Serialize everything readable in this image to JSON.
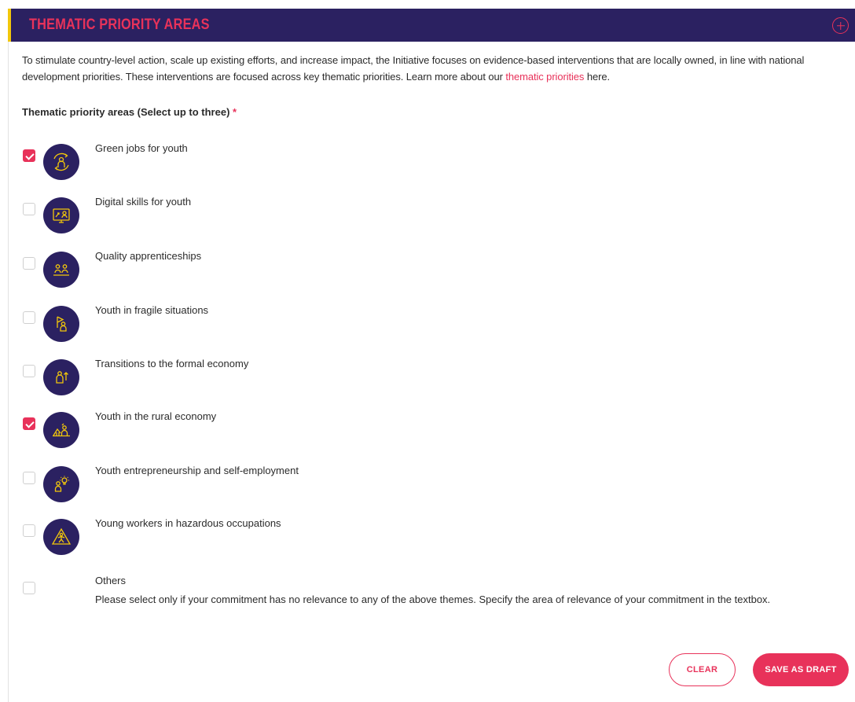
{
  "header": {
    "title": "THEMATIC PRIORITY AREAS",
    "colors": {
      "background": "#2b2161",
      "accent": "#e8325a",
      "edge": "#f2c70b"
    }
  },
  "intro": {
    "text_before": "To stimulate country-level action, scale up existing efforts, and increase impact, the Initiative focuses on evidence-based interventions that are locally owned, in line with national development priorities. These interventions are focused across key thematic priorities. Learn more about our ",
    "link_text": "thematic priorities",
    "text_after": " here."
  },
  "question": {
    "label": "Thematic priority areas (Select up to three)",
    "required_marker": "*"
  },
  "options": [
    {
      "label": "Green jobs for youth",
      "checked": true,
      "icon": "green-jobs-icon"
    },
    {
      "label": "Digital skills for youth",
      "checked": false,
      "icon": "digital-skills-icon"
    },
    {
      "label": "Quality apprenticeships",
      "checked": false,
      "icon": "apprenticeship-icon"
    },
    {
      "label": "Youth in fragile situations",
      "checked": false,
      "icon": "fragile-situations-icon"
    },
    {
      "label": "Transitions to the formal economy",
      "checked": false,
      "icon": "formal-economy-icon"
    },
    {
      "label": "Youth in the rural economy",
      "checked": true,
      "icon": "rural-economy-icon"
    },
    {
      "label": "Youth entrepreneurship and self-employment",
      "checked": false,
      "icon": "entrepreneurship-icon"
    },
    {
      "label": "Young workers in hazardous occupations",
      "checked": false,
      "icon": "hazard-icon"
    },
    {
      "label": "Others",
      "checked": false
    }
  ],
  "others_description": "Please select only if your commitment has no relevance to any of the above themes. Specify the area of relevance of your commitment in the textbox.",
  "buttons": {
    "clear": "CLEAR",
    "save_draft": "SAVE AS DRAFT"
  }
}
